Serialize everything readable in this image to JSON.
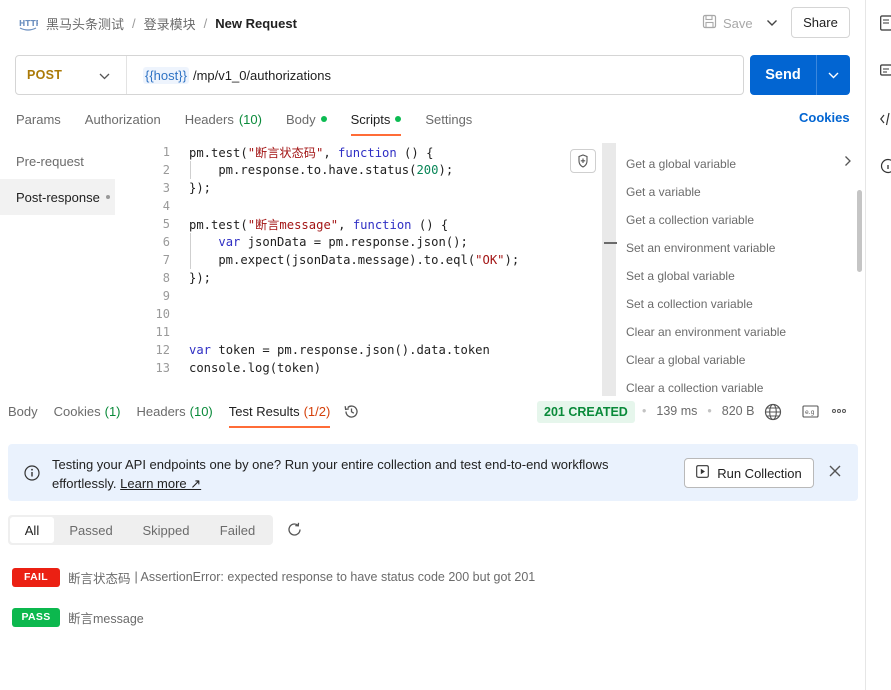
{
  "breadcrumb": {
    "collection": "黑马头条测试",
    "folder": "登录模块",
    "request": "New Request"
  },
  "toolbar": {
    "save_label": "Save",
    "share_label": "Share"
  },
  "request": {
    "method": "POST",
    "url_variable": "{{host}}",
    "url_path": "/mp/v1_0/authorizations",
    "send_label": "Send"
  },
  "request_tabs": [
    {
      "label": "Params"
    },
    {
      "label": "Authorization"
    },
    {
      "label": "Headers",
      "count": "(10)"
    },
    {
      "label": "Body"
    },
    {
      "label": "Scripts"
    },
    {
      "label": "Settings"
    }
  ],
  "cookies_label": "Cookies",
  "script_tabs": [
    {
      "label": "Pre-request"
    },
    {
      "label": "Post-response"
    }
  ],
  "editor": {
    "line_numbers": [
      "1",
      "2",
      "3",
      "4",
      "5",
      "6",
      "7",
      "8",
      "9",
      "10",
      "11",
      "12",
      "13"
    ],
    "lines": [
      [
        "pm.test(",
        "\"断言状态码\"",
        ", ",
        "function",
        " () {"
      ],
      [
        "    pm.response.to.have.status(",
        "200",
        ");"
      ],
      [
        "});"
      ],
      [
        ""
      ],
      [
        "pm.test(",
        "\"断言message\"",
        ", ",
        "function",
        " () {"
      ],
      [
        "    ",
        "var",
        " jsonData = pm.response.json();"
      ],
      [
        "    pm.expect(jsonData.message).to.eql(",
        "\"OK\"",
        ");"
      ],
      [
        "});"
      ],
      [
        ""
      ],
      [
        ""
      ],
      [
        ""
      ],
      [
        "var",
        " token = pm.response.json().data.token"
      ],
      [
        "console.log(token)"
      ]
    ]
  },
  "snippets": [
    "Get a global variable",
    "Get a variable",
    "Get a collection variable",
    "Set an environment variable",
    "Set a global variable",
    "Set a collection variable",
    "Clear an environment variable",
    "Clear a global variable",
    "Clear a collection variable"
  ],
  "response_tabs": [
    {
      "label": "Body"
    },
    {
      "label": "Cookies",
      "count": "(1)"
    },
    {
      "label": "Headers",
      "count": "(10)"
    },
    {
      "label": "Test Results",
      "count": "(1/2)"
    }
  ],
  "response_meta": {
    "status": "201 CREATED",
    "time": "139 ms",
    "size": "820 B"
  },
  "banner": {
    "text": "Testing your API endpoints one by one? Run your entire collection and test end-to-end workflows effortlessly.",
    "link": "Learn more ↗",
    "run_label": "Run Collection"
  },
  "filters": [
    "All",
    "Passed",
    "Skipped",
    "Failed"
  ],
  "results": [
    {
      "status": "FAIL",
      "name": "断言状态码",
      "message": "| AssertionError: expected response to have status code 200 but got 201"
    },
    {
      "status": "PASS",
      "name": "断言message",
      "message": ""
    }
  ],
  "colors": {
    "accent": "#ff6c37",
    "send": "#0265d2",
    "fail": "#eb2013",
    "pass": "#0cb84e",
    "method": "#ab7a07"
  }
}
